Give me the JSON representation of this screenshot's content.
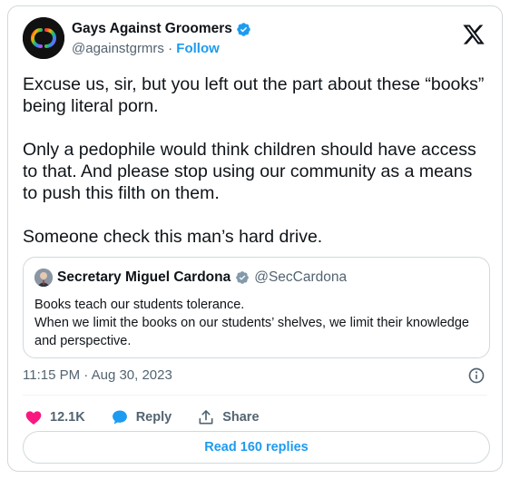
{
  "author": {
    "display_name": "Gays Against Groomers",
    "handle": "@againstgrmrs",
    "separator": "·",
    "follow_label": "Follow"
  },
  "tweet": {
    "text": "Excuse us, sir, but you left out the part about these “books” being literal porn.\n\nOnly a pedophile would think children should have access to that. And please stop using our community as a means to push this filth on them.\n\nSomeone check this man’s hard drive."
  },
  "quote": {
    "display_name": "Secretary Miguel Cardona",
    "handle": "@SecCardona",
    "text": "Books teach our students tolerance.\nWhen we limit the books on our students’ shelves, we limit their knowledge and perspective."
  },
  "meta": {
    "timestamp": "11:15 PM · Aug 30, 2023"
  },
  "actions": {
    "like_count": "12.1K",
    "reply_label": "Reply",
    "share_label": "Share"
  },
  "read_replies_label": "Read 160 replies",
  "colors": {
    "accent": "#1d9bf0",
    "like": "#f91880",
    "text": "#0f1419",
    "secondary": "#536471",
    "border": "#cfd9de"
  },
  "icons": [
    "verified-badge-icon",
    "x-logo-icon",
    "info-icon",
    "heart-icon",
    "reply-bubble-icon",
    "share-icon"
  ]
}
